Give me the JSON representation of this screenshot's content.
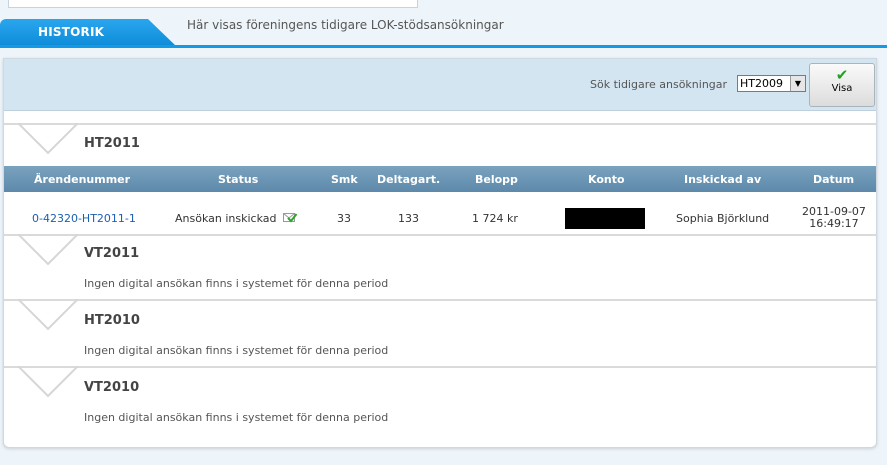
{
  "header": {
    "tab_label": "HISTORIK",
    "description": "Här visas föreningens tidigare LOK-stödsansökningar"
  },
  "search": {
    "label": "Sök tidigare ansökningar",
    "selected_period": "HT2009",
    "button_label": "Visa"
  },
  "table": {
    "columns": [
      "Ärendenummer",
      "Status",
      "Smk",
      "Deltagart.",
      "Belopp",
      "Konto",
      "Inskickad av",
      "Datum"
    ],
    "rows": [
      {
        "case_number": "0-42320-HT2011-1",
        "status": "Ansökan inskickad",
        "smk": "33",
        "deltagart": "133",
        "belopp": "1 724 kr",
        "inskickad_av": "Sophia Björklund",
        "datum": "2011-09-07",
        "tid": "16:49:17"
      }
    ]
  },
  "sections": [
    {
      "title": "HT2011",
      "message": ""
    },
    {
      "title": "VT2011",
      "message": "Ingen digital ansökan finns i systemet för denna period"
    },
    {
      "title": "HT2010",
      "message": "Ingen digital ansökan finns i systemet för denna period"
    },
    {
      "title": "VT2010",
      "message": "Ingen digital ansökan finns i systemet för denna period"
    }
  ],
  "colors": {
    "accent": "#1499e4",
    "table_header": "#5d89aa",
    "search_bar": "#d3e5f1",
    "link": "#1d5fb3"
  },
  "icons": {
    "visa": "check-icon",
    "status": "envelope-check-icon",
    "select": "chevron-down-icon"
  }
}
